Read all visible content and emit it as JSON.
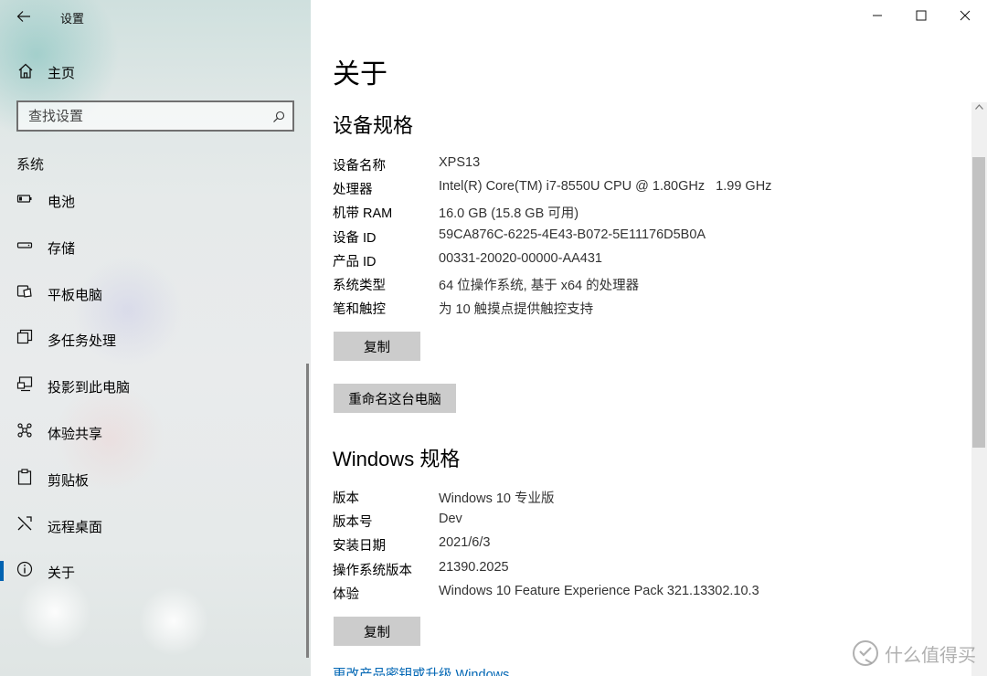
{
  "window": {
    "title": "设置"
  },
  "sidebar": {
    "home_label": "主页",
    "search_placeholder": "查找设置",
    "section_label": "系统",
    "items": [
      {
        "label": "电池",
        "icon": "battery-icon"
      },
      {
        "label": "存储",
        "icon": "storage-icon"
      },
      {
        "label": "平板电脑",
        "icon": "tablet-icon"
      },
      {
        "label": "多任务处理",
        "icon": "multitasking-icon"
      },
      {
        "label": "投影到此电脑",
        "icon": "projecting-icon"
      },
      {
        "label": "体验共享",
        "icon": "shared-experiences-icon"
      },
      {
        "label": "剪贴板",
        "icon": "clipboard-icon"
      },
      {
        "label": "远程桌面",
        "icon": "remote-desktop-icon"
      },
      {
        "label": "关于",
        "icon": "info-icon",
        "active": true
      }
    ]
  },
  "main": {
    "page_title": "关于",
    "device_specs": {
      "heading": "设备规格",
      "rows": [
        {
          "key": "设备名称",
          "value": "XPS13"
        },
        {
          "key": "处理器",
          "value": "Intel(R) Core(TM) i7-8550U CPU @ 1.80GHz   1.99 GHz"
        },
        {
          "key": "机带 RAM",
          "value": "16.0 GB (15.8 GB 可用)"
        },
        {
          "key": "设备 ID",
          "value": "59CA876C-6225-4E43-B072-5E11176D5B0A"
        },
        {
          "key": "产品 ID",
          "value": "00331-20020-00000-AA431"
        },
        {
          "key": "系统类型",
          "value": "64 位操作系统, 基于 x64 的处理器"
        },
        {
          "key": "笔和触控",
          "value": "为 10 触摸点提供触控支持"
        }
      ],
      "copy_button": "复制",
      "rename_button": "重命名这台电脑"
    },
    "windows_specs": {
      "heading": "Windows 规格",
      "rows": [
        {
          "key": "版本",
          "value": "Windows 10 专业版"
        },
        {
          "key": "版本号",
          "value": "Dev"
        },
        {
          "key": "安装日期",
          "value": "2021/6/3"
        },
        {
          "key": "操作系统版本",
          "value": "21390.2025"
        },
        {
          "key": "体验",
          "value": "Windows 10 Feature Experience Pack 321.13302.10.3"
        }
      ],
      "copy_button": "复制",
      "link": "更改产品密钥或升级 Windows"
    }
  },
  "watermark": {
    "text": "什么值得买"
  },
  "colors": {
    "accent": "#0063b1",
    "link": "#0066b4",
    "button_bg": "#cccccc"
  }
}
